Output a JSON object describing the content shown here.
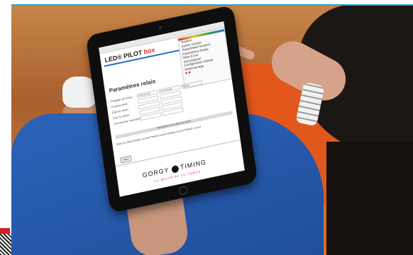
{
  "screen": {
    "logo_main": "LED® PILOT",
    "logo_box": "box",
    "menu_items": [
      "Gestion",
      "Entrée horaire",
      "Paramètres horaires",
      "Paramètres Relais",
      "Mise à jour",
      "micrologiciel",
      "Configuration réseau",
      "Redémarrage"
    ],
    "page_title": "Paramètres relais",
    "row_labels": [
      "Réglage de relais",
      "Position pied",
      "Etat du relais",
      "Etat du relais",
      "Commande manuelle"
    ],
    "column_headers": [
      "Commande",
      "Commande",
      "Défaut"
    ],
    "section_bar": "Paramètres des relais de sortie",
    "relay_label": "Etat du relais",
    "relay_options": [
      "Relais ouvert",
      "Relais ouvert",
      "Relais ouvert",
      "Relais ouvert"
    ],
    "submit_label": "Valider",
    "brand_left": "GORGY",
    "brand_right": "TIMING",
    "tagline": "LA MAÎTRISE DU TEMPS"
  }
}
